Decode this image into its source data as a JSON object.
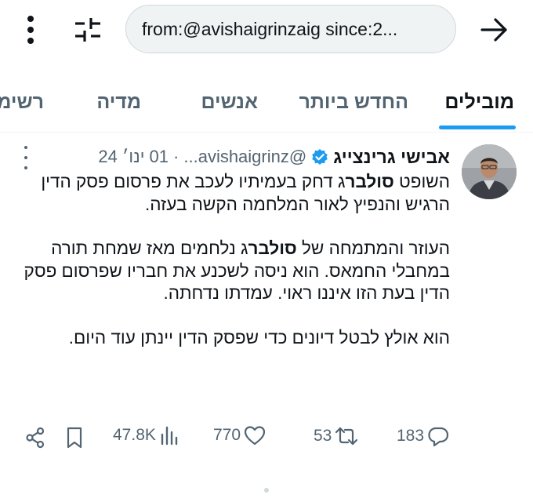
{
  "search": {
    "query": "from:@avishaigrinzaig since:2..."
  },
  "icons": {
    "menu": "more-vertical-icon",
    "filter": "filter-sliders-icon",
    "back": "arrow-right-icon"
  },
  "tabs": [
    {
      "label": "מובילים",
      "active": true
    },
    {
      "label": "החדש ביותר",
      "active": false
    },
    {
      "label": "אנשים",
      "active": false
    },
    {
      "label": "מדיה",
      "active": false
    },
    {
      "label": "רשימ",
      "active": false
    }
  ],
  "tweet": {
    "author_name": "אבישי גרינצייג",
    "handle": "@avishaigrinz...",
    "date_sep": "·",
    "date": "01 ינו׳ 24",
    "para1_prefix": "השופט ",
    "para1_bold": "סולבר",
    "para1_suffix": "ג דחק בעמיתיו לעכב את פרסום פסק הדין הרגיש והנפיץ לאור המלחמה הקשה בעזה.",
    "para2_prefix": "העוזר והמתמחה של ",
    "para2_bold": "סולבר",
    "para2_suffix": "ג נלחמים מאז שמחת תורה במחבלי החמאס. הוא ניסה לשכנע את חבריו שפרסום פסק הדין בעת הזו איננו ראוי.  עמדתו נדחתה.",
    "para3": "הוא אולץ לבטל דיונים כדי שפסק הדין יינתן עוד היום.",
    "stats": {
      "replies": "183",
      "retweets": "53",
      "likes": "770",
      "views": "47.8K"
    }
  },
  "colors": {
    "accent": "#1d9bf0",
    "verified": "#1d9bf0",
    "text": "#0f1419",
    "muted": "#536471"
  }
}
